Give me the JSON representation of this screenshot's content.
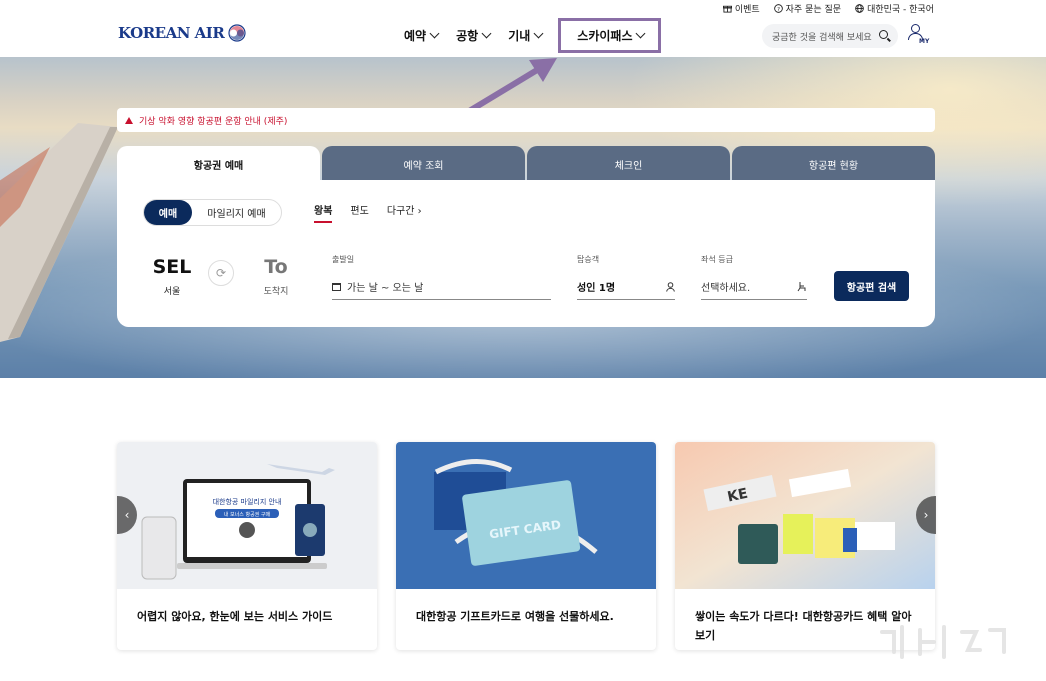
{
  "utility": {
    "events": "이벤트",
    "faq": "자주 묻는 질문",
    "region": "대한민국 - 한국어"
  },
  "header": {
    "logo": "KOREAN AIR",
    "nav": [
      {
        "label": "예약"
      },
      {
        "label": "공항"
      },
      {
        "label": "기내"
      },
      {
        "label": "스카이패스"
      }
    ],
    "search_placeholder": "궁금한 것을 검색해 보세요",
    "my_label": "MY"
  },
  "notice": "기상 악화 영향 항공편 운항 안내 (제주)",
  "tabs": [
    {
      "label": "항공권 예매",
      "active": true
    },
    {
      "label": "예약 조회",
      "active": false
    },
    {
      "label": "체크인",
      "active": false
    },
    {
      "label": "항공편 현황",
      "active": false
    }
  ],
  "booking": {
    "toggle_on": "예매",
    "toggle_off": "마일리지 예매",
    "trip_types": [
      "왕복",
      "편도",
      "다구간"
    ],
    "origin": {
      "code": "SEL",
      "city": "서울"
    },
    "destination": {
      "code": "To",
      "city": "도착지"
    },
    "depart_label": "출발일",
    "depart_placeholder": "가는 날 ~ 오는 날",
    "pax_label": "탑승객",
    "pax_value": "성인 1명",
    "class_label": "좌석 등급",
    "class_placeholder": "선택하세요.",
    "search_button": "항공편 검색"
  },
  "cards": [
    {
      "title": "어렵지 않아요, 한눈에 보는 서비스 가이드",
      "image_text": "대한항공 마일리지 안내",
      "image_sub": "내 보너스 항공권 구매"
    },
    {
      "title": "대한항공 기프트카드로 여행을 선물하세요.",
      "image_text": "GIFT CARD"
    },
    {
      "title": "쌓이는 속도가 다르다! 대한항공카드 혜택 알아보기",
      "image_text": "KE"
    }
  ],
  "colors": {
    "navy": "#0b2a5c",
    "tab_inactive": "#5a6b84",
    "alert_red": "#c8102e",
    "highlight": "#8a6fa6"
  }
}
